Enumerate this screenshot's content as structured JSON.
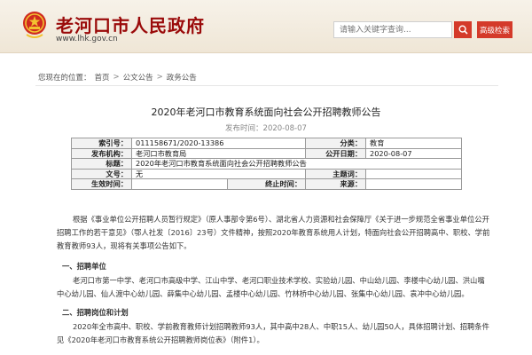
{
  "site": {
    "title": "老河口市人民政府",
    "url": "www.lhk.gov.cn"
  },
  "search": {
    "placeholder": "请输入关键字查询...",
    "advanced_label": "高级检索"
  },
  "breadcrumb": {
    "prefix": "您现在的位置：",
    "items": [
      "首页",
      "公文公告",
      "政务公告"
    ],
    "separator": ">"
  },
  "article": {
    "title": "2020年老河口市教育系统面向社会公开招聘教师公告",
    "publish_date": "发布时间：2020-08-07"
  },
  "meta": {
    "index_label": "索引号：",
    "index_value": "011158671/2020-13386",
    "category_label": "分类：",
    "category_value": "教育",
    "publisher_label": "发布机构：",
    "publisher_value": "老河口市教育局",
    "pubdate_label": "公开日期：",
    "pubdate_value": "2020-08-07",
    "title_label": "标题：",
    "title_value": "2020年老河口市教育系统面向社会公开招聘教师公告",
    "docno_label": "文号：",
    "docno_value": "无",
    "keywords_label": "主题词：",
    "keywords_value": "",
    "effective_label": "生效时间：",
    "effective_value": "",
    "expire_label": "终止时间：",
    "expire_value": "",
    "source_label": "来源：",
    "source_value": ""
  },
  "content": {
    "p1": "根据《事业单位公开招聘人员暂行规定》（原人事部令第6号）、湖北省人力资源和社会保障厅《关于进一步规范全省事业单位公开招聘工作的若干意见》（鄂人社发〔2016〕23号）文件精神，按照2020年教育系统用人计划，特面向社会公开招聘高中、职校、学前教育教师93人，现将有关事项公告如下。",
    "h1": "一、招聘单位",
    "p2": "老河口市第一中学、老河口市高级中学、江山中学、老河口职业技术学校、实验幼儿园、中山幼儿园、李楼中心幼儿园、洪山嘴中心幼儿园、仙人渡中心幼儿园、薛集中心幼儿园、孟楼中心幼儿园、竹林桥中心幼儿园、张集中心幼儿园、袁冲中心幼儿园。",
    "h2": "二、招聘岗位和计划",
    "p3": "2020年全市高中、职校、学前教育教师计划招聘教师93人，其中高中28人、中职15人、幼儿园50人，具体招聘计划、招聘条件见《2020年老河口市教育系统公开招聘教师岗位表》（附件1）。"
  },
  "colors": {
    "brand_red": "#9a0a0a",
    "button_red": "#d43a2a",
    "header_bg": "#f3ece0"
  },
  "icons": {
    "emblem": "national-emblem-icon",
    "search": "search-icon"
  }
}
